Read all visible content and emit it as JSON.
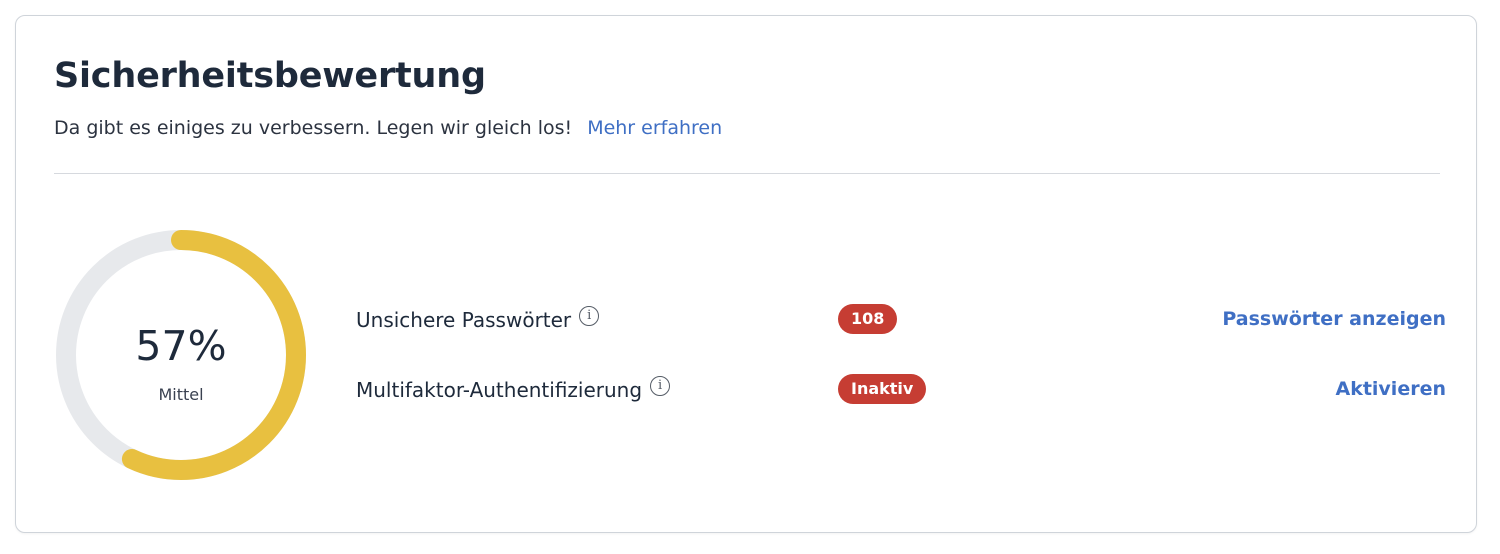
{
  "header": {
    "title": "Sicherheitsbewertung",
    "subtitle": "Da gibt es einiges zu verbessern. Legen wir gleich los!",
    "learn_more_label": "Mehr erfahren"
  },
  "score": {
    "value_text": "57%",
    "fraction": 0.57,
    "rating_label": "Mittel",
    "progress_color": "#e8c040",
    "track_color": "#e7e9ec"
  },
  "items": [
    {
      "label": "Unsichere Passwörter",
      "info_icon": "info-icon",
      "badge": "108",
      "badge_color": "#c63d33",
      "action_label": "Passwörter anzeigen"
    },
    {
      "label": "Multifaktor-Authentifizierung",
      "info_icon": "info-icon",
      "badge": "Inaktiv",
      "badge_color": "#c63d33",
      "action_label": "Aktivieren"
    }
  ],
  "colors": {
    "link": "#3f6fc4",
    "heading": "#1e2a3b"
  }
}
